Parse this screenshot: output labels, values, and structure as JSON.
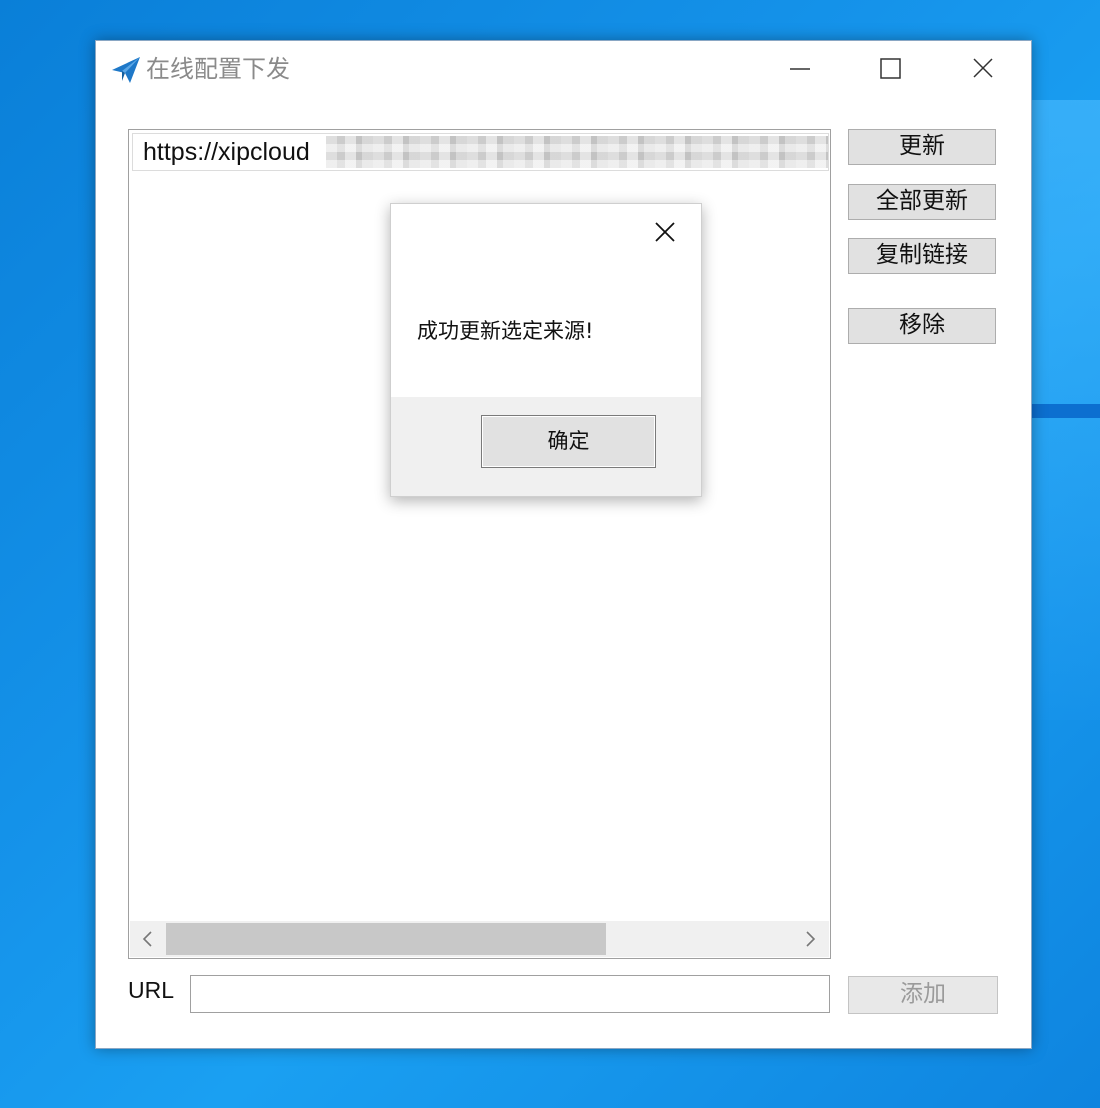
{
  "window": {
    "title": "在线配置下发",
    "controls": {
      "minimize": "minimize-icon",
      "maximize": "maximize-icon",
      "close": "close-icon"
    }
  },
  "sources": {
    "items": [
      {
        "url": "https://xipcloud"
      }
    ]
  },
  "buttons": {
    "update": "更新",
    "update_all": "全部更新",
    "copy_link": "复制链接",
    "remove": "移除",
    "add": "添加"
  },
  "url_field": {
    "label": "URL",
    "value": ""
  },
  "dialog": {
    "message": "成功更新选定来源!",
    "ok_label": "确定"
  },
  "colors": {
    "accent": "#1e78c8",
    "desktop": "#1593ea"
  }
}
